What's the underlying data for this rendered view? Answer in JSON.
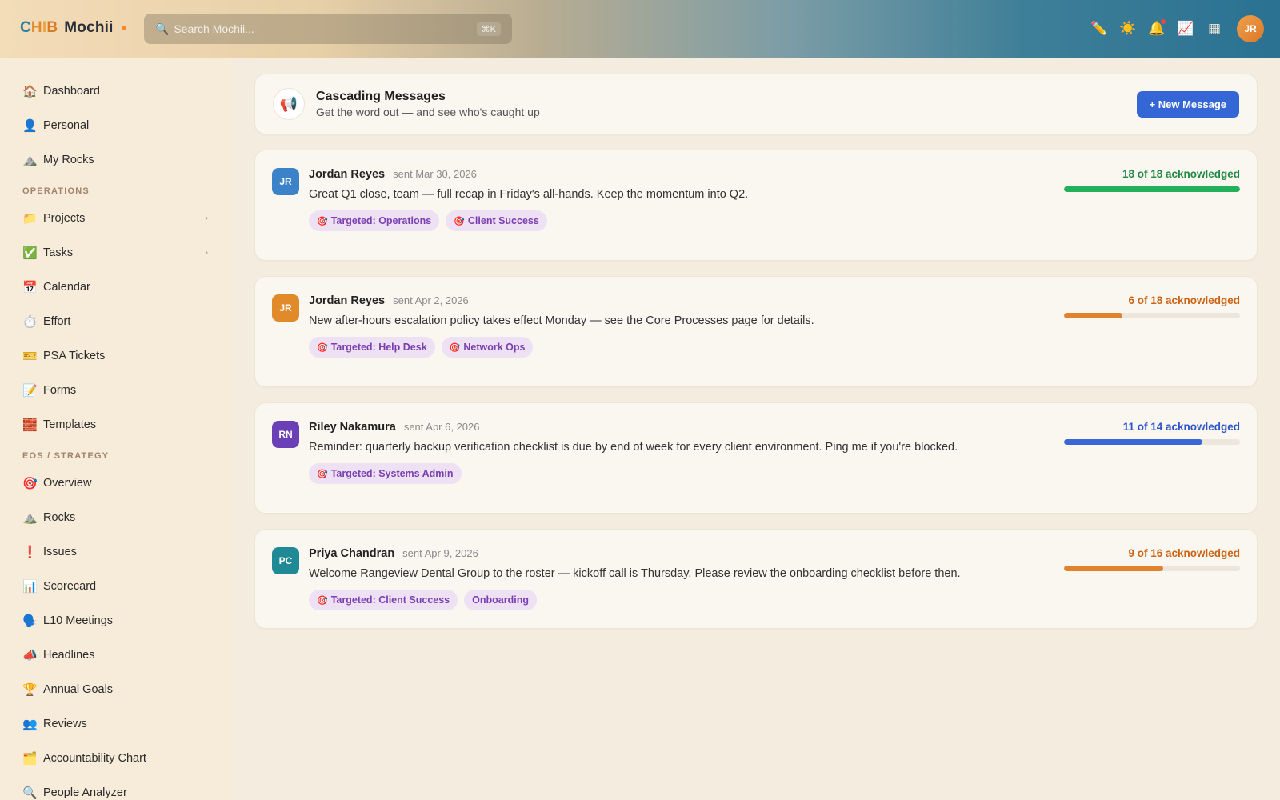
{
  "brand": {
    "letters": [
      "C",
      "H",
      "I",
      "B"
    ],
    "name": "Mochii"
  },
  "search": {
    "placeholder": "Search Mochii...",
    "shortcut": "⌘K"
  },
  "header_icons": [
    "pencil-icon",
    "sun-icon",
    "bell-icon",
    "chart-icon",
    "grid-icon"
  ],
  "user": {
    "initials": "JR"
  },
  "sidebar": {
    "top_items": [
      {
        "label": "Dashboard",
        "icon": "🏠"
      },
      {
        "label": "Personal",
        "icon": "👤"
      },
      {
        "label": "My Rocks",
        "icon": "⛰️"
      }
    ],
    "operations_label": "OPERATIONS",
    "operations_items": [
      {
        "label": "Projects",
        "icon": "📁",
        "chevron": "›"
      },
      {
        "label": "Tasks",
        "icon": "✅",
        "chevron": "›"
      },
      {
        "label": "Calendar",
        "icon": "📅"
      },
      {
        "label": "Effort",
        "icon": "⏱️"
      },
      {
        "label": "PSA Tickets",
        "icon": "🎫"
      },
      {
        "label": "Forms",
        "icon": "📝"
      },
      {
        "label": "Templates",
        "icon": "🧱"
      }
    ],
    "eos_label": "EOS / STRATEGY",
    "eos_items": [
      {
        "label": "Overview",
        "icon": "🎯"
      },
      {
        "label": "Rocks",
        "icon": "⛰️"
      },
      {
        "label": "Issues",
        "icon": "❗"
      },
      {
        "label": "Scorecard",
        "icon": "📊"
      },
      {
        "label": "L10 Meetings",
        "icon": "🗣️"
      },
      {
        "label": "Headlines",
        "icon": "📣"
      },
      {
        "label": "Annual Goals",
        "icon": "🏆"
      },
      {
        "label": "Reviews",
        "icon": "👥"
      },
      {
        "label": "Accountability Chart",
        "icon": "🗂️"
      },
      {
        "label": "People Analyzer",
        "icon": "🔍"
      }
    ]
  },
  "page": {
    "icon": "📢",
    "title": "Cascading Messages",
    "subtitle": "Get the word out — and see who's caught up",
    "new_button": "+ New Message"
  },
  "messages": [
    {
      "author": "Jordan Reyes",
      "initials": "JR",
      "date": "sent Mar 30, 2026",
      "text": "Great Q1 close, team — full recap in Friday's all-hands. Keep the momentum into Q2.",
      "tags": [
        {
          "label": "Targeted: Operations",
          "targeted": true
        },
        {
          "label": "Client Success",
          "targeted": true
        }
      ],
      "ack_label": "18 of 18 acknowledged",
      "ack_fraction": 1.0,
      "ack_color": "#1f8a45",
      "bar_color": "#22b05a",
      "avatar_color": "#3b82c9"
    },
    {
      "author": "Jordan Reyes",
      "initials": "JR",
      "date": "sent Apr 2, 2026",
      "text": "New after-hours escalation policy takes effect Monday — see the Core Processes page for details.",
      "tags": [
        {
          "label": "Targeted: Help Desk",
          "targeted": true
        },
        {
          "label": "Network Ops",
          "targeted": true
        }
      ],
      "ack_label": "6 of 18 acknowledged",
      "ack_fraction": 0.333,
      "ack_color": "#cc6414",
      "bar_color": "#e3822e",
      "avatar_color": "#e08a2a"
    },
    {
      "author": "Riley Nakamura",
      "initials": "RN",
      "date": "sent Apr 6, 2026",
      "text": "Reminder: quarterly backup verification checklist is due by end of week for every client environment. Ping me if you're blocked.",
      "tags": [
        {
          "label": "Targeted: Systems Admin",
          "targeted": true
        }
      ],
      "ack_label": "11 of 14 acknowledged",
      "ack_fraction": 0.786,
      "ack_color": "#2f56c9",
      "bar_color": "#3b66d6",
      "avatar_color": "#6b3fb5"
    },
    {
      "author": "Priya Chandran",
      "initials": "PC",
      "date": "sent Apr 9, 2026",
      "text": "Welcome Rangeview Dental Group to the roster — kickoff call is Thursday. Please review the onboarding checklist before then.",
      "tags": [
        {
          "label": "Targeted: Client Success",
          "targeted": true
        },
        {
          "label": "Onboarding",
          "targeted": false
        }
      ],
      "ack_label": "9 of 16 acknowledged",
      "ack_fraction": 0.5625,
      "ack_color": "#cc6414",
      "bar_color": "#e3822e",
      "avatar_color": "#1f8a95"
    }
  ]
}
